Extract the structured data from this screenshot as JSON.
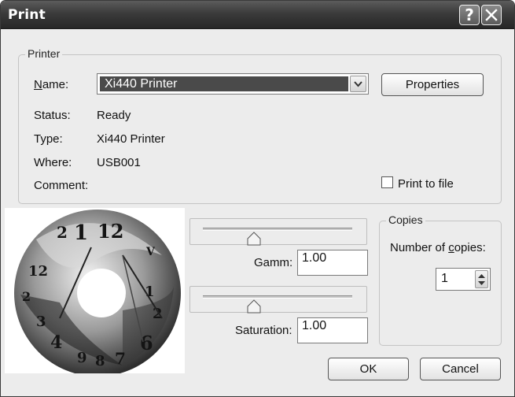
{
  "window": {
    "title": "Print",
    "help_glyph": "?"
  },
  "printer": {
    "group_label": "Printer",
    "name_label": "Name:",
    "selected_printer": "Xi440 Printer",
    "properties_button": "Properties",
    "status_label": "Status:",
    "status_value": "Ready",
    "type_label": "Type:",
    "type_value": "Xi440 Printer",
    "where_label": "Where:",
    "where_value": "USB001",
    "comment_label": "Comment:",
    "print_to_file_label": "Print to file",
    "print_to_file_checked": false
  },
  "adjustments": {
    "gamma_label": "Gamm:",
    "gamma_value": "1.00",
    "saturation_label": "Saturation:",
    "saturation_value": "1.00"
  },
  "copies": {
    "group_label": "Copies",
    "number_label": "Number of copies:",
    "value": "1"
  },
  "buttons": {
    "ok": "OK",
    "cancel": "Cancel"
  },
  "icons": {
    "help": "help-icon",
    "close": "close-icon",
    "dropdown": "chevron-down-icon",
    "slider_thumb": "slider-thumb-icon",
    "spinner": "spinner-icon"
  },
  "colors": {
    "titlebar": "#3b3b3b",
    "selection": "#4a4a4a",
    "dialog_bg": "#ececec"
  }
}
